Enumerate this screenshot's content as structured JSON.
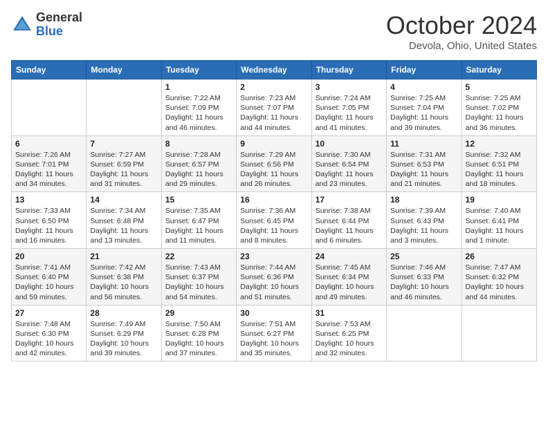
{
  "header": {
    "logo_general": "General",
    "logo_blue": "Blue",
    "title": "October 2024",
    "location": "Devola, Ohio, United States"
  },
  "weekdays": [
    "Sunday",
    "Monday",
    "Tuesday",
    "Wednesday",
    "Thursday",
    "Friday",
    "Saturday"
  ],
  "weeks": [
    [
      {
        "day": "",
        "detail": ""
      },
      {
        "day": "",
        "detail": ""
      },
      {
        "day": "1",
        "detail": "Sunrise: 7:22 AM\nSunset: 7:09 PM\nDaylight: 11 hours and 46 minutes."
      },
      {
        "day": "2",
        "detail": "Sunrise: 7:23 AM\nSunset: 7:07 PM\nDaylight: 11 hours and 44 minutes."
      },
      {
        "day": "3",
        "detail": "Sunrise: 7:24 AM\nSunset: 7:05 PM\nDaylight: 11 hours and 41 minutes."
      },
      {
        "day": "4",
        "detail": "Sunrise: 7:25 AM\nSunset: 7:04 PM\nDaylight: 11 hours and 39 minutes."
      },
      {
        "day": "5",
        "detail": "Sunrise: 7:25 AM\nSunset: 7:02 PM\nDaylight: 11 hours and 36 minutes."
      }
    ],
    [
      {
        "day": "6",
        "detail": "Sunrise: 7:26 AM\nSunset: 7:01 PM\nDaylight: 11 hours and 34 minutes."
      },
      {
        "day": "7",
        "detail": "Sunrise: 7:27 AM\nSunset: 6:59 PM\nDaylight: 11 hours and 31 minutes."
      },
      {
        "day": "8",
        "detail": "Sunrise: 7:28 AM\nSunset: 6:57 PM\nDaylight: 11 hours and 29 minutes."
      },
      {
        "day": "9",
        "detail": "Sunrise: 7:29 AM\nSunset: 6:56 PM\nDaylight: 11 hours and 26 minutes."
      },
      {
        "day": "10",
        "detail": "Sunrise: 7:30 AM\nSunset: 6:54 PM\nDaylight: 11 hours and 23 minutes."
      },
      {
        "day": "11",
        "detail": "Sunrise: 7:31 AM\nSunset: 6:53 PM\nDaylight: 11 hours and 21 minutes."
      },
      {
        "day": "12",
        "detail": "Sunrise: 7:32 AM\nSunset: 6:51 PM\nDaylight: 11 hours and 18 minutes."
      }
    ],
    [
      {
        "day": "13",
        "detail": "Sunrise: 7:33 AM\nSunset: 6:50 PM\nDaylight: 11 hours and 16 minutes."
      },
      {
        "day": "14",
        "detail": "Sunrise: 7:34 AM\nSunset: 6:48 PM\nDaylight: 11 hours and 13 minutes."
      },
      {
        "day": "15",
        "detail": "Sunrise: 7:35 AM\nSunset: 6:47 PM\nDaylight: 11 hours and 11 minutes."
      },
      {
        "day": "16",
        "detail": "Sunrise: 7:36 AM\nSunset: 6:45 PM\nDaylight: 11 hours and 8 minutes."
      },
      {
        "day": "17",
        "detail": "Sunrise: 7:38 AM\nSunset: 6:44 PM\nDaylight: 11 hours and 6 minutes."
      },
      {
        "day": "18",
        "detail": "Sunrise: 7:39 AM\nSunset: 6:43 PM\nDaylight: 11 hours and 3 minutes."
      },
      {
        "day": "19",
        "detail": "Sunrise: 7:40 AM\nSunset: 6:41 PM\nDaylight: 11 hours and 1 minute."
      }
    ],
    [
      {
        "day": "20",
        "detail": "Sunrise: 7:41 AM\nSunset: 6:40 PM\nDaylight: 10 hours and 59 minutes."
      },
      {
        "day": "21",
        "detail": "Sunrise: 7:42 AM\nSunset: 6:38 PM\nDaylight: 10 hours and 56 minutes."
      },
      {
        "day": "22",
        "detail": "Sunrise: 7:43 AM\nSunset: 6:37 PM\nDaylight: 10 hours and 54 minutes."
      },
      {
        "day": "23",
        "detail": "Sunrise: 7:44 AM\nSunset: 6:36 PM\nDaylight: 10 hours and 51 minutes."
      },
      {
        "day": "24",
        "detail": "Sunrise: 7:45 AM\nSunset: 6:34 PM\nDaylight: 10 hours and 49 minutes."
      },
      {
        "day": "25",
        "detail": "Sunrise: 7:46 AM\nSunset: 6:33 PM\nDaylight: 10 hours and 46 minutes."
      },
      {
        "day": "26",
        "detail": "Sunrise: 7:47 AM\nSunset: 6:32 PM\nDaylight: 10 hours and 44 minutes."
      }
    ],
    [
      {
        "day": "27",
        "detail": "Sunrise: 7:48 AM\nSunset: 6:30 PM\nDaylight: 10 hours and 42 minutes."
      },
      {
        "day": "28",
        "detail": "Sunrise: 7:49 AM\nSunset: 6:29 PM\nDaylight: 10 hours and 39 minutes."
      },
      {
        "day": "29",
        "detail": "Sunrise: 7:50 AM\nSunset: 6:28 PM\nDaylight: 10 hours and 37 minutes."
      },
      {
        "day": "30",
        "detail": "Sunrise: 7:51 AM\nSunset: 6:27 PM\nDaylight: 10 hours and 35 minutes."
      },
      {
        "day": "31",
        "detail": "Sunrise: 7:53 AM\nSunset: 6:25 PM\nDaylight: 10 hours and 32 minutes."
      },
      {
        "day": "",
        "detail": ""
      },
      {
        "day": "",
        "detail": ""
      }
    ]
  ]
}
